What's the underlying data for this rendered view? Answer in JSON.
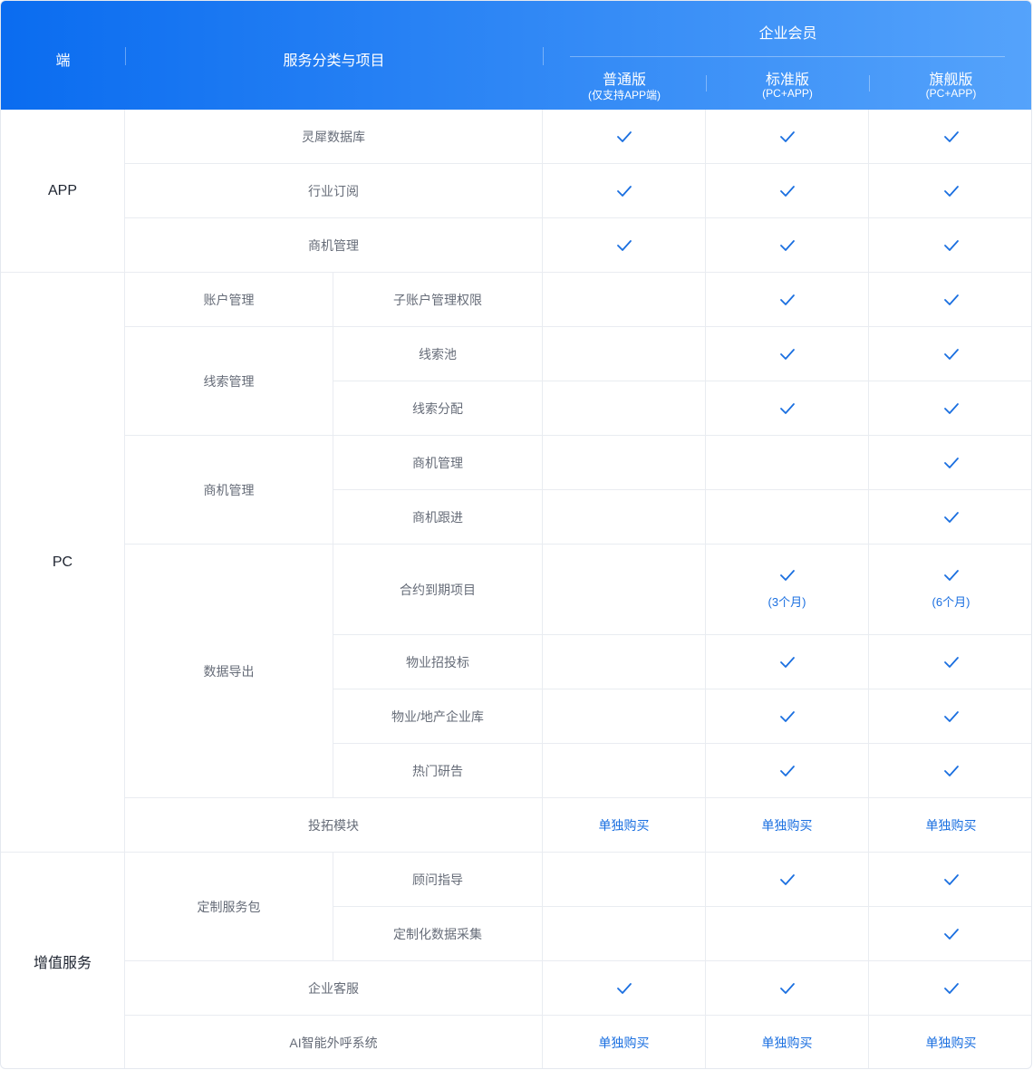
{
  "header": {
    "platform": "端",
    "service": "服务分类与项目",
    "membership": "企业会员",
    "plans": [
      {
        "name": "普通版",
        "sub": "(仅支持APP端)"
      },
      {
        "name": "标准版",
        "sub": "(PC+APP)"
      },
      {
        "name": "旗舰版",
        "sub": "(PC+APP)"
      }
    ]
  },
  "platforms": {
    "app": "APP",
    "pc": "PC",
    "vas": "增值服务"
  },
  "groups": {
    "account": "账户管理",
    "leads": "线索管理",
    "biz": "商机管理",
    "export": "数据导出",
    "custom": "定制服务包"
  },
  "rows": [
    {
      "item": "灵犀数据库",
      "cells": [
        "check",
        "check",
        "check"
      ]
    },
    {
      "item": "行业订阅",
      "cells": [
        "check",
        "check",
        "check"
      ]
    },
    {
      "item": "商机管理",
      "cells": [
        "check",
        "check",
        "check"
      ]
    },
    {
      "item": "子账户管理权限",
      "cells": [
        "",
        "check",
        "check"
      ]
    },
    {
      "item": "线索池",
      "cells": [
        "",
        "check",
        "check"
      ]
    },
    {
      "item": "线索分配",
      "cells": [
        "",
        "check",
        "check"
      ]
    },
    {
      "item": "商机管理",
      "cells": [
        "",
        "",
        "check"
      ]
    },
    {
      "item": "商机跟进",
      "cells": [
        "",
        "",
        "check"
      ]
    },
    {
      "item": "合约到期项目",
      "cells": [
        "",
        "check",
        "check"
      ],
      "notes": [
        "",
        "(3个月)",
        "(6个月)"
      ]
    },
    {
      "item": "物业招投标",
      "cells": [
        "",
        "check",
        "check"
      ]
    },
    {
      "item": "物业/地产企业库",
      "cells": [
        "",
        "check",
        "check"
      ]
    },
    {
      "item": "热门研告",
      "cells": [
        "",
        "check",
        "check"
      ]
    },
    {
      "item": "投拓模块",
      "cells": [
        "buy",
        "buy",
        "buy"
      ]
    },
    {
      "item": "顾问指导",
      "cells": [
        "",
        "check",
        "check"
      ]
    },
    {
      "item": "定制化数据采集",
      "cells": [
        "",
        "",
        "check"
      ]
    },
    {
      "item": "企业客服",
      "cells": [
        "check",
        "check",
        "check"
      ]
    },
    {
      "item": "AI智能外呼系统",
      "cells": [
        "buy",
        "buy",
        "buy"
      ]
    }
  ],
  "buy_label": "单独购买",
  "colors": {
    "accent": "#1a6fe0",
    "header_start": "#0a6cf0",
    "header_end": "#55a3fb"
  }
}
